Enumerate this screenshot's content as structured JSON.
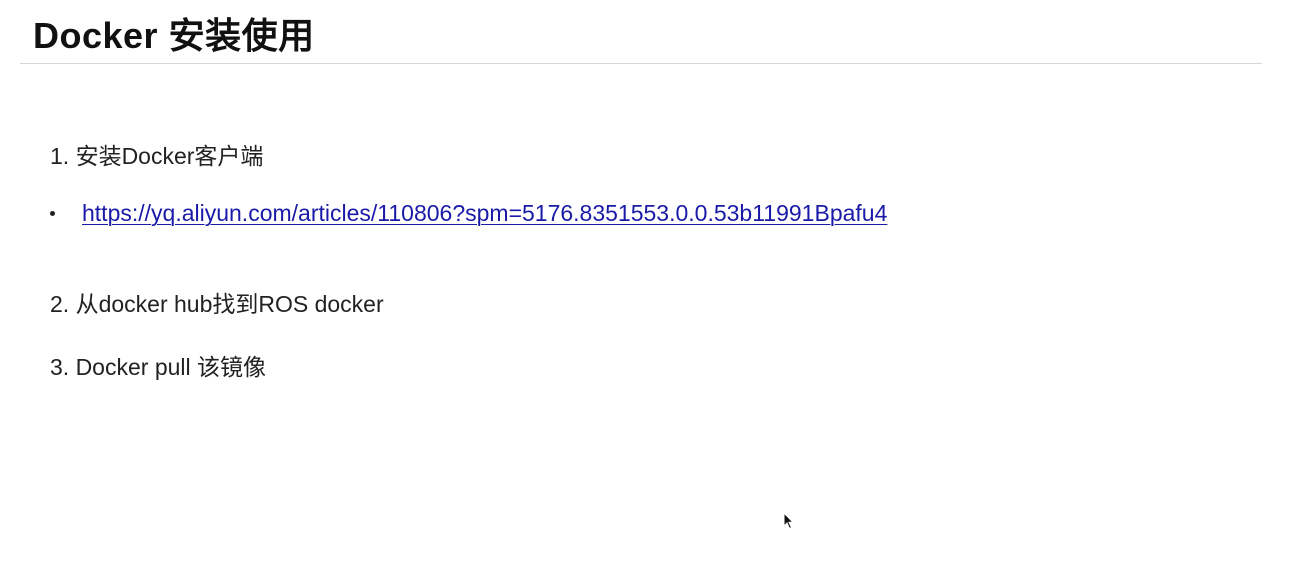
{
  "slide": {
    "title": "Docker 安装使用",
    "steps": [
      {
        "label": "1. 安装Docker客户端"
      },
      {
        "label": "2. 从docker hub找到ROS docker"
      },
      {
        "label": "3. Docker pull 该镜像"
      }
    ],
    "link": {
      "text": "https://yq.aliyun.com/articles/110806?spm=5176.8351553.0.0.53b11991Bpafu4",
      "color": "#1a1aa8"
    }
  },
  "icons": {
    "cursor": "mouse-pointer-icon"
  }
}
